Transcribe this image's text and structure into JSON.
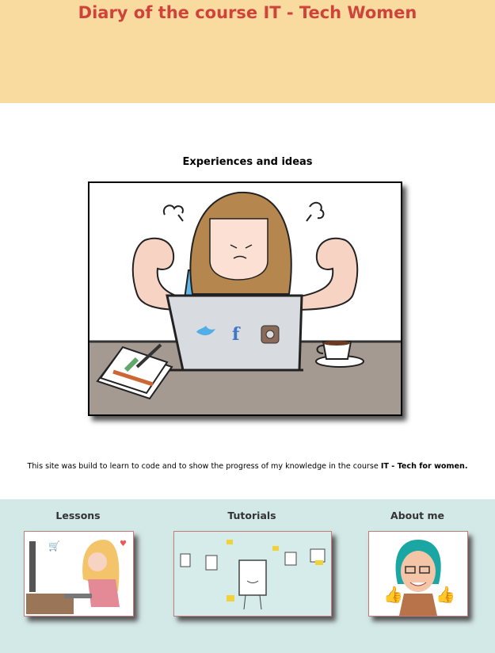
{
  "header": {
    "title": "Diary of the course IT - Tech Women",
    "background": "#f9dba0",
    "title_color": "#d0433a"
  },
  "main": {
    "heading": "Experiences and ideas",
    "intro_prefix": "This site was build to learn to code and to show the progress of my knowledge in the course ",
    "intro_bold": "IT - Tech for women."
  },
  "footer": {
    "background": "#d3e9e8",
    "cards": [
      {
        "title": "Lessons"
      },
      {
        "title": "Tutorials"
      },
      {
        "title": "About me"
      }
    ]
  }
}
